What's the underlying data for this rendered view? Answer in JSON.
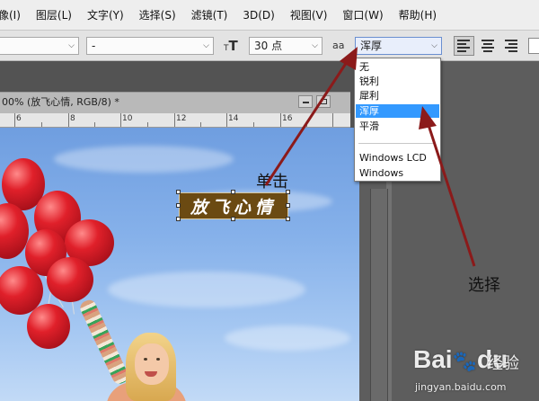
{
  "menu": [
    "像(I)",
    "图层(L)",
    "文字(Y)",
    "选择(S)",
    "滤镜(T)",
    "3D(D)",
    "视图(V)",
    "窗口(W)",
    "帮助(H)"
  ],
  "options_bar": {
    "font_style_value": "-",
    "font_size_value": "30 点",
    "aa_label": "aa",
    "antialias_value": "浑厚",
    "text_orient_glyph": "T"
  },
  "antialias_dropdown": {
    "options": [
      "无",
      "锐利",
      "犀利",
      "浑厚",
      "平滑"
    ],
    "extra_options": [
      "Windows LCD",
      "Windows"
    ],
    "selected": "浑厚"
  },
  "document": {
    "tab_title": "00% (放飞心情, RGB/8) *",
    "ruler_numbers": [
      "6",
      "8",
      "10",
      "12",
      "14",
      "16"
    ],
    "text_layer": "放飞心情"
  },
  "annotations": {
    "click": "单击",
    "select": "选择"
  },
  "watermark": {
    "logo": "Bai",
    "logo_suffix": "du",
    "brand": "经验",
    "url": "jingyan.baidu.com"
  },
  "colors": {
    "accent_highlight": "#3399ff",
    "annotation_arrow": "#8b1a1a",
    "text_layer_bg": "#6b4a12"
  }
}
